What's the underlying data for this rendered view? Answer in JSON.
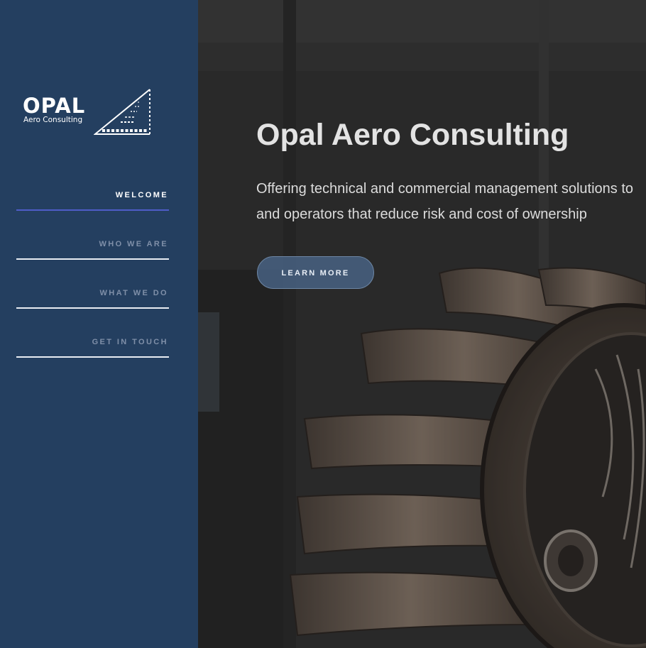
{
  "brand": {
    "name": "OPAL",
    "tagline": "Aero Consulting"
  },
  "nav": {
    "items": [
      {
        "label": "WELCOME",
        "active": true
      },
      {
        "label": "WHO WE ARE",
        "active": false
      },
      {
        "label": "WHAT WE DO",
        "active": false
      },
      {
        "label": "GET IN TOUCH",
        "active": false
      }
    ]
  },
  "hero": {
    "title": "Opal Aero Consulting",
    "text_line1": "Offering technical and commercial management solutions to",
    "text_line2": "and operators that reduce risk and cost of ownership",
    "button_label": "LEARN MORE",
    "background_image": "jet-engine-fan-photo"
  },
  "colors": {
    "sidebar": "#243f60",
    "active_underline": "#4f5cc8",
    "button": "#4a678b"
  }
}
